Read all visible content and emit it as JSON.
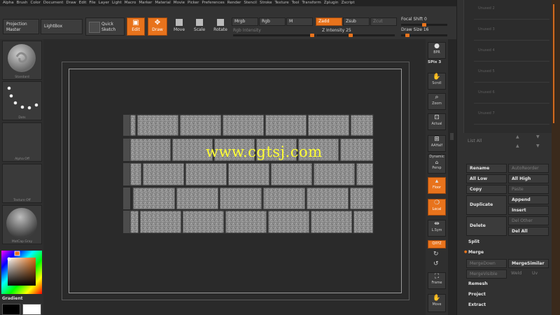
{
  "menu": [
    "Alpha",
    "Brush",
    "Color",
    "Document",
    "Draw",
    "Edit",
    "File",
    "Layer",
    "Light",
    "Macro",
    "Marker",
    "Material",
    "Movie",
    "Picker",
    "Preferences",
    "Render",
    "Stencil",
    "Stroke",
    "Texture",
    "Tool",
    "Transform",
    "Zplugin",
    "Zscript"
  ],
  "toolbar": {
    "projection_master": "Projection Master",
    "lightbox": "LightBox",
    "quick_sketch": "Quick Sketch",
    "edit": "Edit",
    "draw": "Draw",
    "move": "Move",
    "scale": "Scale",
    "rotate": "Rotate",
    "mrgb": "Mrgb",
    "rgb": "Rgb",
    "m": "M",
    "zadd": "Zadd",
    "zsub": "Zsub",
    "zcut": "Zcut",
    "rgb_intensity": "Rgb Intensity",
    "z_intensity_label": "Z Intensity",
    "z_intensity_value": "25",
    "focal_shift_label": "Focal Shift",
    "focal_shift_value": "0",
    "draw_size_label": "Draw Size",
    "draw_size_value": "16"
  },
  "leftshelf": {
    "brush": "Standard",
    "stroke": "Dots",
    "alpha": "Alpha Off",
    "texture": "Texture Off",
    "material": "MatCap Gray",
    "gradient": "Gradient"
  },
  "canvas": {
    "watermark": "www.cgtsj.com"
  },
  "rightshelf": {
    "bpr": "BPR",
    "spix_label": "SPix",
    "spix_value": "3",
    "scroll": "Scroll",
    "zoom": "Zoom",
    "actual": "Actual",
    "aahalf": "AAHalf",
    "persp_top": "Dynamic",
    "persp": "Persp",
    "floor": "Floor",
    "local": "Local",
    "lsym": "L.Sym",
    "qxyz": "QXYZ",
    "frame": "Frame",
    "move": "Move"
  },
  "subtool": {
    "slots": [
      "Unused 2",
      "Unused 3",
      "Unused 4",
      "Unused 5",
      "Unused 6",
      "Unused 7"
    ],
    "list_all": "List All",
    "rename": "Rename",
    "autoreorder": "AutoReorder",
    "all_low": "All Low",
    "all_high": "All High",
    "copy": "Copy",
    "paste": "Paste",
    "duplicate": "Duplicate",
    "append": "Append",
    "insert": "Insert",
    "delete": "Delete",
    "del_other": "Del Other",
    "del_all": "Del All",
    "split": "Split",
    "merge": "Merge",
    "merge_down": "MergeDown",
    "merge_similar": "MergeSimilar",
    "merge_visible": "MergeVisible",
    "weld": "Weld",
    "uv": "Uv",
    "remesh": "Remesh",
    "project": "Project",
    "extract": "Extract"
  },
  "colors": {
    "accent": "#e8731c",
    "watermark": "#ffff33"
  }
}
